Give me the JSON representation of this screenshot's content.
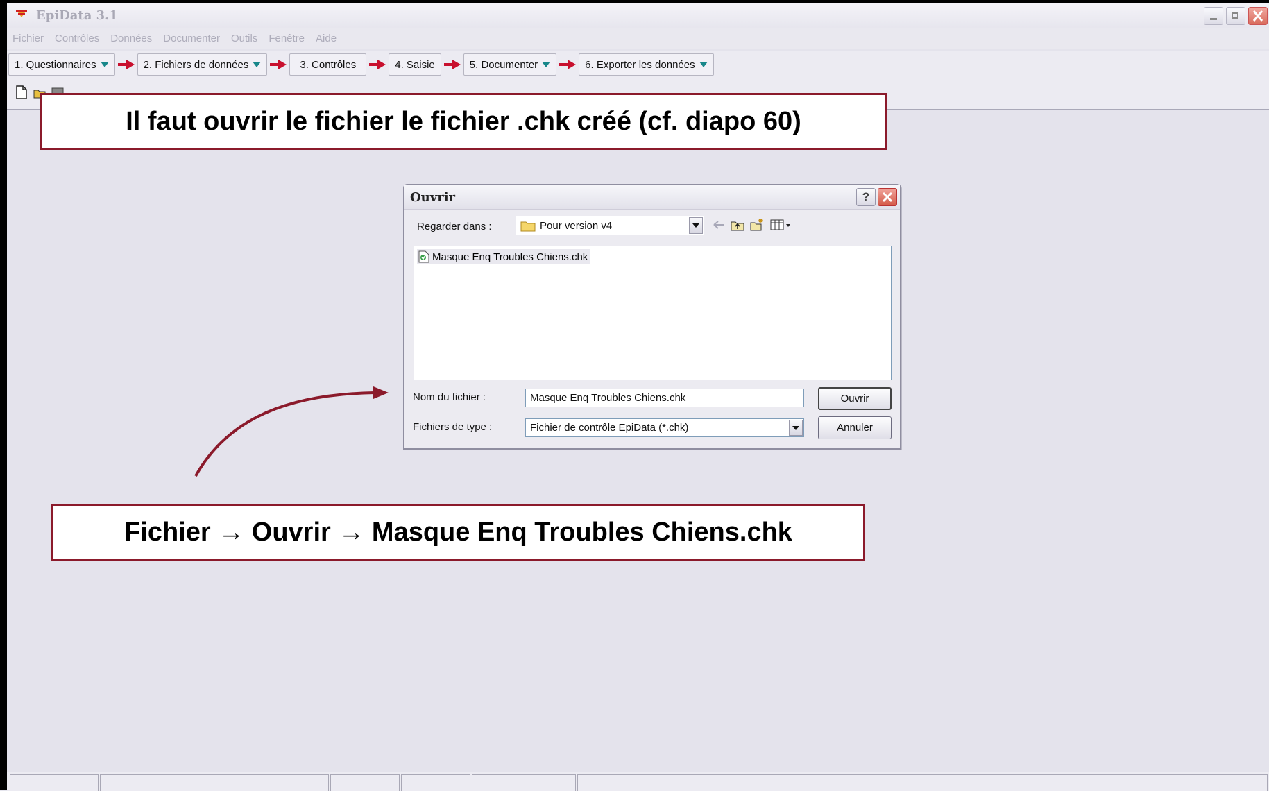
{
  "window": {
    "title": "EpiData 3.1"
  },
  "menu": [
    "Fichier",
    "Contrôles",
    "Données",
    "Documenter",
    "Outils",
    "Fenêtre",
    "Aide"
  ],
  "workflow": [
    {
      "num": "1",
      "label": ". Questionnaires"
    },
    {
      "num": "2",
      "label": ". Fichiers de données"
    },
    {
      "num": "3",
      "label": ". Contrôles"
    },
    {
      "num": "4",
      "label": ". Saisie"
    },
    {
      "num": "5",
      "label": ". Documenter"
    },
    {
      "num": "6",
      "label": ". Exporter les données"
    }
  ],
  "callouts": {
    "top": "Il faut ouvrir le fichier le fichier .chk créé (cf. diapo 60)",
    "bottom": "Fichier → Ouvrir → Masque Enq Troubles Chiens.chk"
  },
  "dialog": {
    "title": "Ouvrir",
    "help_label": "?",
    "look_in_label": "Regarder dans :",
    "look_in_value": "Pour version v4",
    "files": [
      "Masque Enq Troubles Chiens.chk"
    ],
    "filename_label": "Nom du fichier :",
    "filename_value": "Masque Enq Troubles Chiens.chk",
    "filetype_label": "Fichiers de type :",
    "filetype_value": "Fichier de contrôle EpiData (*.chk)",
    "open_label": "Ouvrir",
    "cancel_label": "Annuler"
  },
  "colors": {
    "callout_border": "#8b1a2b",
    "arrow": "#8b1a2b",
    "dropdown_triangle": "#18878a"
  }
}
